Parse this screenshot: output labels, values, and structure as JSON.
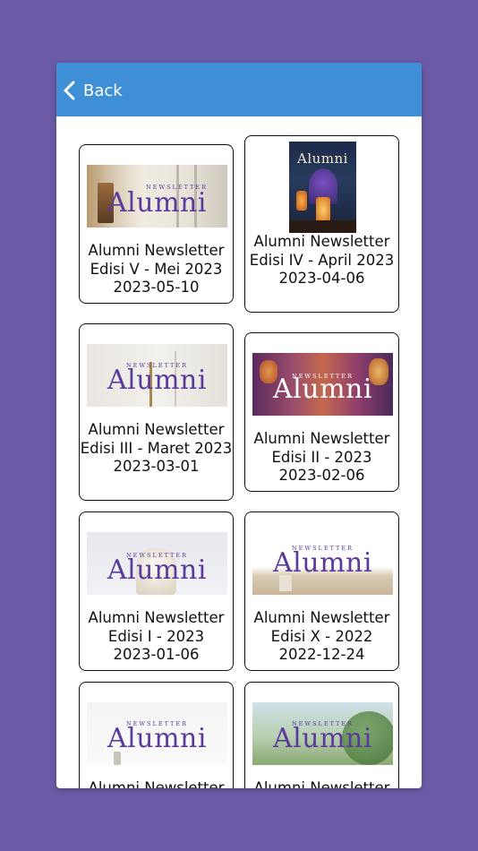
{
  "header": {
    "back_label": "Back"
  },
  "cover_text": {
    "masthead": "Alumni",
    "newsletter": "NEWSLETTER"
  },
  "newsletters": [
    {
      "title": "Alumni Newsletter Edisi V - Mei 2023",
      "date": "2023-05-10"
    },
    {
      "title": "Alumni Newsletter Edisi IV - April 2023",
      "date": "2023-04-06"
    },
    {
      "title": "Alumni Newsletter Edisi III - Maret 2023",
      "date": "2023-03-01"
    },
    {
      "title": "Alumni Newsletter Edisi II - 2023",
      "date": "2023-02-06"
    },
    {
      "title": "Alumni Newsletter Edisi I - 2023",
      "date": "2023-01-06"
    },
    {
      "title": "Alumni Newsletter Edisi X - 2022",
      "date": "2022-12-24"
    },
    {
      "title": "Alumni Newsletter",
      "date": ""
    },
    {
      "title": "Alumni Newsletter",
      "date": ""
    }
  ],
  "colors": {
    "background": "#6b5aa6",
    "header": "#3f8fd6",
    "masthead": "#5a3b9c"
  }
}
